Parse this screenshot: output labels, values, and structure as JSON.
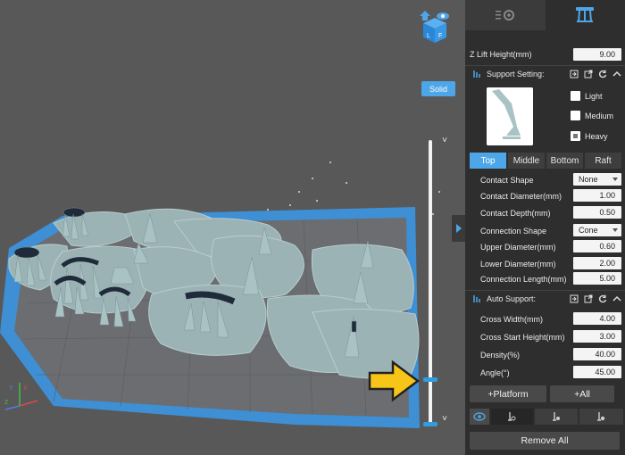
{
  "viewport": {
    "solid_label": "Solid",
    "up_arrow": "˅",
    "down_arrow": "˅",
    "axis_x": "X",
    "axis_y": "Y",
    "axis_z": "Z",
    "cube_faces": [
      "L",
      "F"
    ]
  },
  "panel": {
    "tabs": [
      {
        "icon": "gear-sliders-icon",
        "active": false
      },
      {
        "icon": "support-tree-icon",
        "active": true
      }
    ],
    "z_lift": {
      "label": "Z Lift Height(mm)",
      "value": "9.00"
    },
    "support_setting": {
      "title": "Support Setting:",
      "presets": [
        {
          "label": "Light",
          "checked": false
        },
        {
          "label": "Medium",
          "checked": false
        },
        {
          "label": "Heavy",
          "checked": true
        }
      ],
      "level_tabs": [
        {
          "label": "Top",
          "active": true
        },
        {
          "label": "Middle",
          "active": false
        },
        {
          "label": "Bottom",
          "active": false
        },
        {
          "label": "Raft",
          "active": false
        }
      ],
      "fields": [
        {
          "label": "Contact Shape",
          "value": "None",
          "type": "select"
        },
        {
          "label": "Contact Diameter(mm)",
          "value": "1.00",
          "type": "number"
        },
        {
          "label": "Contact Depth(mm)",
          "value": "0.50",
          "type": "number"
        },
        {
          "label": "Connection Shape",
          "value": "Cone",
          "type": "select"
        },
        {
          "label": "Upper Diameter(mm)",
          "value": "0.60",
          "type": "number"
        },
        {
          "label": "Lower Diameter(mm)",
          "value": "2.00",
          "type": "number"
        },
        {
          "label": "Connection Length(mm)",
          "value": "5.00",
          "type": "number"
        }
      ]
    },
    "auto_support": {
      "title": "Auto Support:",
      "fields": [
        {
          "label": "Cross Width(mm)",
          "value": "4.00"
        },
        {
          "label": "Cross Start Height(mm)",
          "value": "3.00"
        },
        {
          "label": "Density(%)",
          "value": "40.00"
        },
        {
          "label": "Angle(°)",
          "value": "45.00"
        }
      ]
    },
    "platform_button": "+Platform",
    "all_button": "+All",
    "remove_all_button": "Remove All"
  },
  "colors": {
    "accent": "#4da6e8",
    "panel_bg": "#2e2e2e",
    "viewport_bg": "#585858",
    "model": "#9fb8b9",
    "plate_border": "#3e8fd4",
    "arrow": "#f7c518"
  }
}
